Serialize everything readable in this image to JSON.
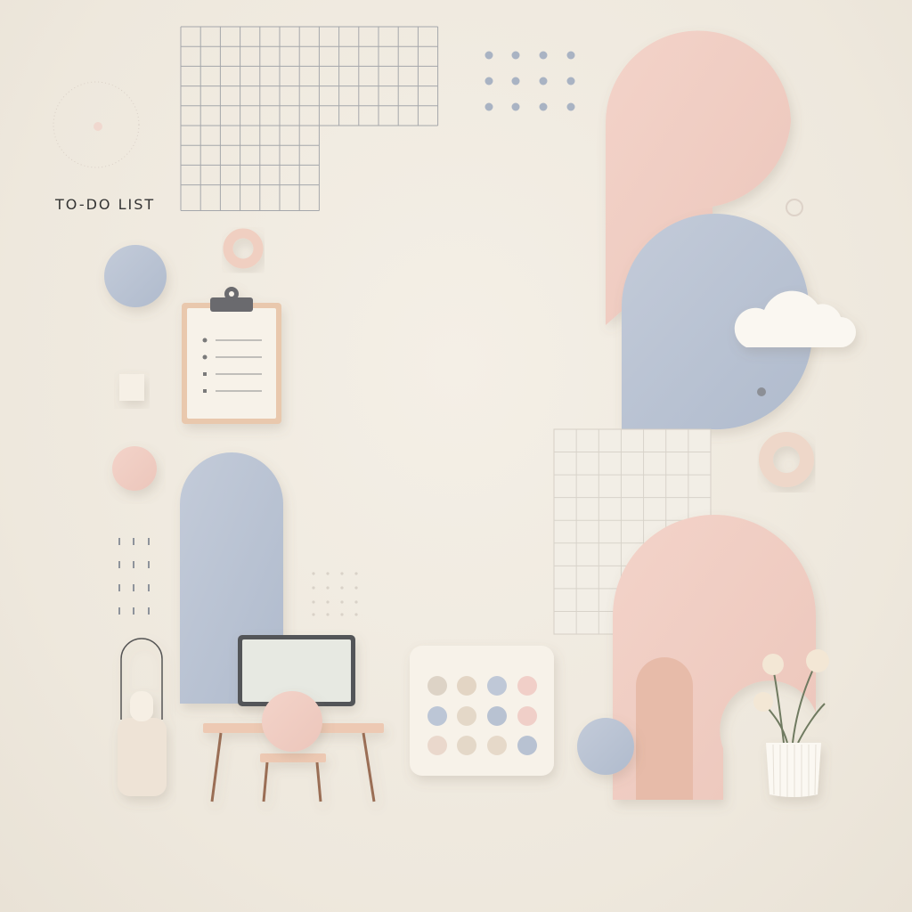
{
  "title": "TO-DO LIST",
  "palette": {
    "background": "#efe9df",
    "pink": "#f0cdc3",
    "blue": "#b7c1d2",
    "cream": "#f6f1e8",
    "tan": "#e7c8b3",
    "wood": "#b38466"
  },
  "icons": {
    "clipboard": "clipboard-icon",
    "laptop": "laptop-icon",
    "cloud": "cloud-icon",
    "calendar": "dot-calendar-icon",
    "plant": "flower-vase-icon",
    "lamp": "lamp-icon",
    "desk": "desk-icon"
  }
}
